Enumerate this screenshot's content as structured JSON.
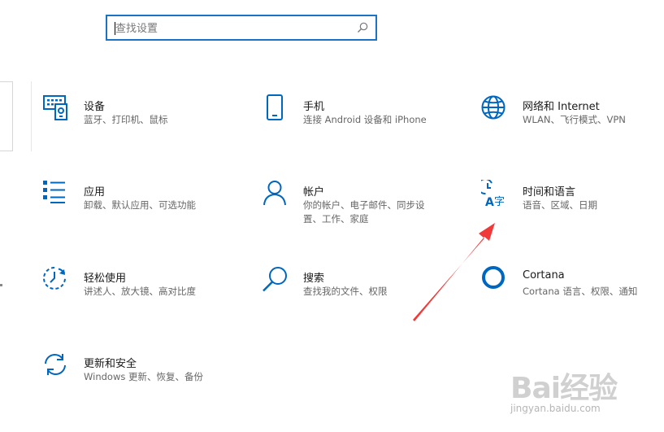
{
  "search": {
    "placeholder": "查找设置"
  },
  "tiles": [
    {
      "id": "devices",
      "title": "设备",
      "desc": "蓝牙、打印机、鼠标",
      "icon": "keyboard-devices-icon"
    },
    {
      "id": "phone",
      "title": "手机",
      "desc": "连接 Android 设备和 iPhone",
      "icon": "phone-icon"
    },
    {
      "id": "network",
      "title": "网络和 Internet",
      "desc": "WLAN、飞行模式、VPN",
      "icon": "globe-icon"
    },
    {
      "id": "apps",
      "title": "应用",
      "desc": "卸载、默认应用、可选功能",
      "icon": "apps-list-icon"
    },
    {
      "id": "accounts",
      "title": "帐户",
      "desc": "你的帐户、电子邮件、同步设置、工作、家庭",
      "icon": "person-icon"
    },
    {
      "id": "time-language",
      "title": "时间和语言",
      "desc": "语音、区域、日期",
      "icon": "time-language-icon"
    },
    {
      "id": "ease-of-access",
      "title": "轻松使用",
      "desc": "讲述人、放大镜、高对比度",
      "icon": "ease-of-access-icon"
    },
    {
      "id": "search",
      "title": "搜索",
      "desc": "查找我的文件、权限",
      "icon": "magnifier-icon"
    },
    {
      "id": "cortana",
      "title": "Cortana",
      "desc": "Cortana 语言、权限、通知",
      "icon": "cortana-circle-icon"
    },
    {
      "id": "update-security",
      "title": "更新和安全",
      "desc": "Windows 更新、恢复、备份",
      "icon": "sync-arrows-icon"
    }
  ],
  "watermark": {
    "logo": "Bai经验",
    "url": "jingyan.baidu.com"
  },
  "colors": {
    "accent": "#0067c0",
    "annotation_arrow": "#f03a3a"
  }
}
